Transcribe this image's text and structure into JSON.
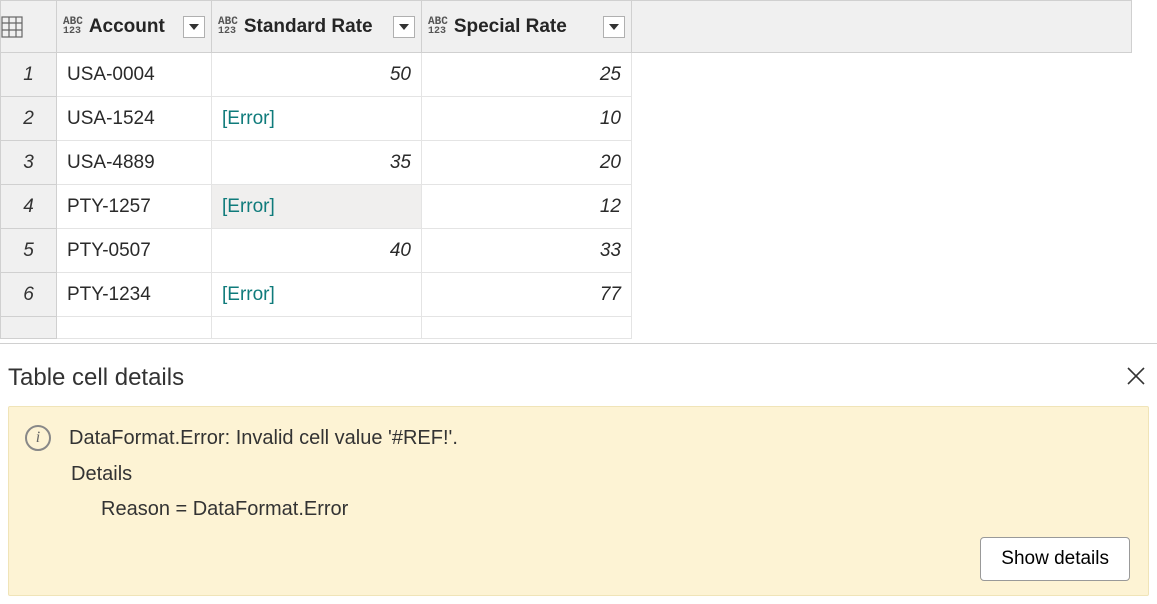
{
  "table": {
    "columns": [
      {
        "label": "Account",
        "type": "ABC123"
      },
      {
        "label": "Standard Rate",
        "type": "ABC123"
      },
      {
        "label": "Special Rate",
        "type": "ABC123"
      }
    ],
    "rows": [
      {
        "num": "1",
        "account": "USA-0004",
        "standard": "50",
        "standard_err": false,
        "special": "25"
      },
      {
        "num": "2",
        "account": "USA-1524",
        "standard": "[Error]",
        "standard_err": true,
        "special": "10"
      },
      {
        "num": "3",
        "account": "USA-4889",
        "standard": "35",
        "standard_err": false,
        "special": "20"
      },
      {
        "num": "4",
        "account": "PTY-1257",
        "standard": "[Error]",
        "standard_err": true,
        "special": "12",
        "selected": true
      },
      {
        "num": "5",
        "account": "PTY-0507",
        "standard": "40",
        "standard_err": false,
        "special": "33"
      },
      {
        "num": "6",
        "account": "PTY-1234",
        "standard": "[Error]",
        "standard_err": true,
        "special": "77"
      }
    ]
  },
  "details": {
    "title": "Table cell details",
    "message": "DataFormat.Error: Invalid cell value '#REF!'.",
    "sub": "Details",
    "reason": "Reason = DataFormat.Error",
    "show_details": "Show details"
  },
  "chart_data": {
    "type": "table",
    "columns": [
      "Account",
      "Standard Rate",
      "Special Rate"
    ],
    "rows": [
      [
        "USA-0004",
        50,
        25
      ],
      [
        "USA-1524",
        "[Error]",
        10
      ],
      [
        "USA-4889",
        35,
        20
      ],
      [
        "PTY-1257",
        "[Error]",
        12
      ],
      [
        "PTY-0507",
        40,
        33
      ],
      [
        "PTY-1234",
        "[Error]",
        77
      ]
    ]
  }
}
